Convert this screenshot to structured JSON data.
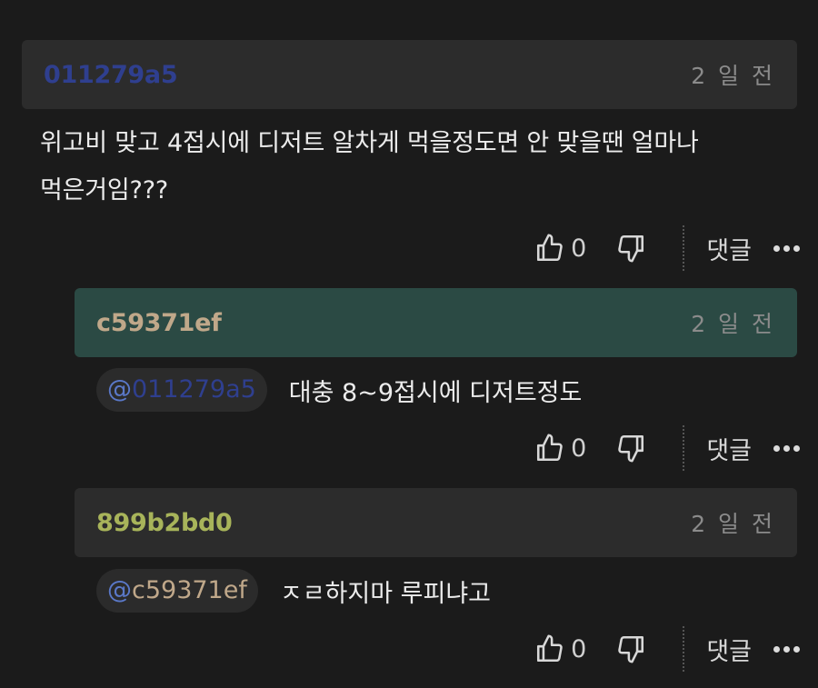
{
  "colors": {
    "nick_1": "#2f3f8f",
    "nick_2": "#c0a88a",
    "nick_3": "#a8b45a",
    "mention_at": "#5a78c8"
  },
  "comments": [
    {
      "nick": "011279a5",
      "time": "2 일 전",
      "body_line1": "위고비 맞고 4접시에 디저트 알차게 먹을정도면 안 맞을땐 얼마나",
      "body_line2": "먹은거임???",
      "likes": "0",
      "reply_label": "댓글"
    },
    {
      "nick": "c59371ef",
      "time": "2 일 전",
      "mention_at": "@",
      "mention_user": "011279a5",
      "body": "대충 8~9접시에 디저트정도",
      "likes": "0",
      "reply_label": "댓글"
    },
    {
      "nick": "899b2bd0",
      "time": "2 일 전",
      "mention_at": "@",
      "mention_user": "c59371ef",
      "body": "ㅈㄹ하지마 루피냐고",
      "likes": "0",
      "reply_label": "댓글"
    }
  ]
}
